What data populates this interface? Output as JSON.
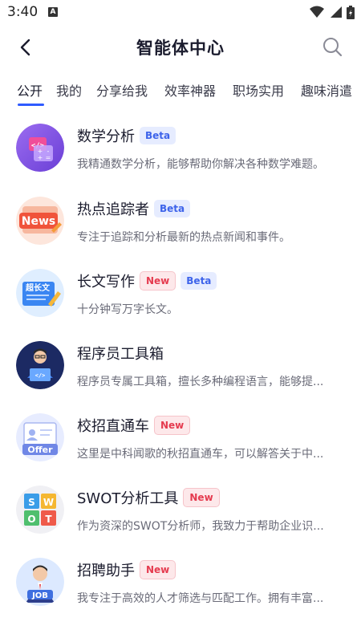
{
  "status_bar": {
    "time": "3:40",
    "notification_letter": "A"
  },
  "header": {
    "title": "智能体中心"
  },
  "tabs": [
    {
      "label": "公开"
    },
    {
      "label": "我的"
    },
    {
      "label": "分享给我"
    },
    {
      "label": "效率神器"
    },
    {
      "label": "职场实用"
    },
    {
      "label": "趣味消遣"
    }
  ],
  "active_tab": "公开",
  "badge_labels": {
    "beta": "Beta",
    "new": "New"
  },
  "agents": [
    {
      "name": "数学分析",
      "desc": "我精通数学分析，能够帮助你解决各种数学难题。",
      "icon": "math-analysis-icon"
    },
    {
      "name": "热点追踪者",
      "desc": "专注于追踪和分析最新的热点新闻和事件。",
      "icon": "news-icon"
    },
    {
      "name": "长文写作",
      "desc": "十分钟写万字长文。",
      "icon": "long-text-icon"
    },
    {
      "name": "程序员工具箱",
      "desc": "程序员专属工具箱，擅长多种编程语言，能够提...",
      "icon": "programmer-icon"
    },
    {
      "name": "校招直通车",
      "desc": "这里是中科闻歌的秋招直通车，可以解答关于中...",
      "icon": "offer-icon"
    },
    {
      "name": "SWOT分析工具",
      "desc": "作为资深的SWOT分析师，我致力于帮助企业识...",
      "icon": "swot-icon"
    },
    {
      "name": "招聘助手",
      "desc": "我专注于高效的人才筛选与匹配工作。拥有丰富...",
      "icon": "job-icon"
    }
  ],
  "colors": {
    "accent": "#2f5bff",
    "beta_bg": "#e6ecff",
    "beta_text": "#3d63ea",
    "new_bg": "#fde8ea",
    "new_text": "#e53b4f"
  }
}
